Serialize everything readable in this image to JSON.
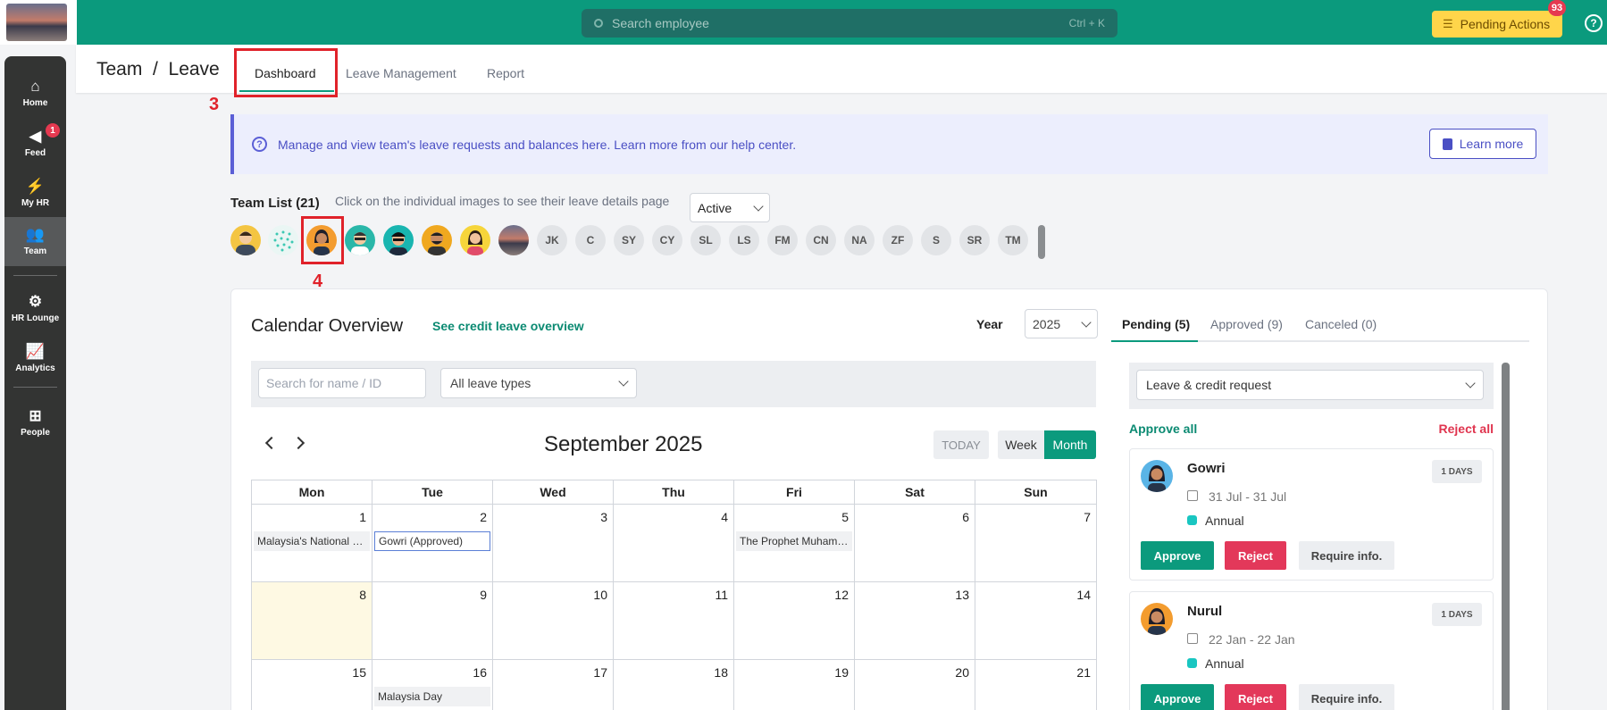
{
  "topbar": {
    "search_placeholder": "Search employee",
    "search_shortcut": "Ctrl + K",
    "pending_actions_label": "Pending Actions",
    "pending_actions_count": "93"
  },
  "sidebar": {
    "items": [
      {
        "label": "Home",
        "icon": "home-icon"
      },
      {
        "label": "Feed",
        "icon": "megaphone-icon",
        "badge": "1"
      },
      {
        "label": "My HR",
        "icon": "lightning-icon"
      },
      {
        "label": "Team",
        "icon": "team-icon",
        "active": true
      },
      {
        "label": "HR Lounge",
        "icon": "users-gear-icon"
      },
      {
        "label": "Analytics",
        "icon": "chart-line-icon"
      },
      {
        "label": "People",
        "icon": "org-chart-icon"
      }
    ]
  },
  "header": {
    "breadcrumb": "Team  /  Leave",
    "tabs": [
      "Dashboard",
      "Leave Management",
      "Report"
    ],
    "active_tab": "Dashboard"
  },
  "annotations": {
    "tab_marker": "3",
    "avatar_marker": "4"
  },
  "banner": {
    "text": "Manage and view team's leave requests and balances here. Learn more from our help center.",
    "learn_more": "Learn more"
  },
  "team": {
    "title": "Team List (21)",
    "hint": "Click on the individual images to see their leave details page",
    "status": "Active",
    "initials": [
      "JK",
      "C",
      "SY",
      "CY",
      "SL",
      "LS",
      "FM",
      "CN",
      "NA",
      "ZF",
      "S",
      "SR",
      "TM"
    ]
  },
  "calendar": {
    "title": "Calendar Overview",
    "credit_link": "See credit leave overview",
    "year_label": "Year",
    "year": "2025",
    "search_placeholder": "Search for name / ID",
    "leave_type": "All leave types",
    "month": "September 2025",
    "today_btn": "TODAY",
    "week_btn": "Week",
    "month_btn": "Month",
    "weekdays": [
      "Mon",
      "Tue",
      "Wed",
      "Thu",
      "Fri",
      "Sat",
      "Sun"
    ],
    "weeks": [
      [
        "1",
        "2",
        "3",
        "4",
        "5",
        "6",
        "7"
      ],
      [
        "8",
        "9",
        "10",
        "11",
        "12",
        "13",
        "14"
      ],
      [
        "15",
        "16",
        "17",
        "18",
        "19",
        "20",
        "21"
      ]
    ],
    "events": {
      "malaysia_national": "Malaysia's National Day",
      "gowri": "Gowri (Approved)",
      "prophet": "The Prophet Muhammad's Birthday",
      "malaysia_day": "Malaysia Day"
    }
  },
  "requests": {
    "tabs": [
      "Pending (5)",
      "Approved (9)",
      "Canceled (0)"
    ],
    "filter": "Leave & credit request",
    "approve_all": "Approve all",
    "reject_all": "Reject all",
    "items": [
      {
        "name": "Gowri",
        "days": "1 DAYS",
        "dates": "31 Jul - 31 Jul",
        "type": "Annual"
      },
      {
        "name": "Nurul",
        "days": "1 DAYS",
        "dates": "22 Jan - 22 Jan",
        "type": "Annual"
      }
    ],
    "approve": "Approve",
    "reject": "Reject",
    "require_info": "Require info."
  },
  "colors": {
    "brand": "#0b9a7d",
    "danger": "#e3385a",
    "accent": "#4a4fc4",
    "today_bg": "#fef9e3"
  }
}
